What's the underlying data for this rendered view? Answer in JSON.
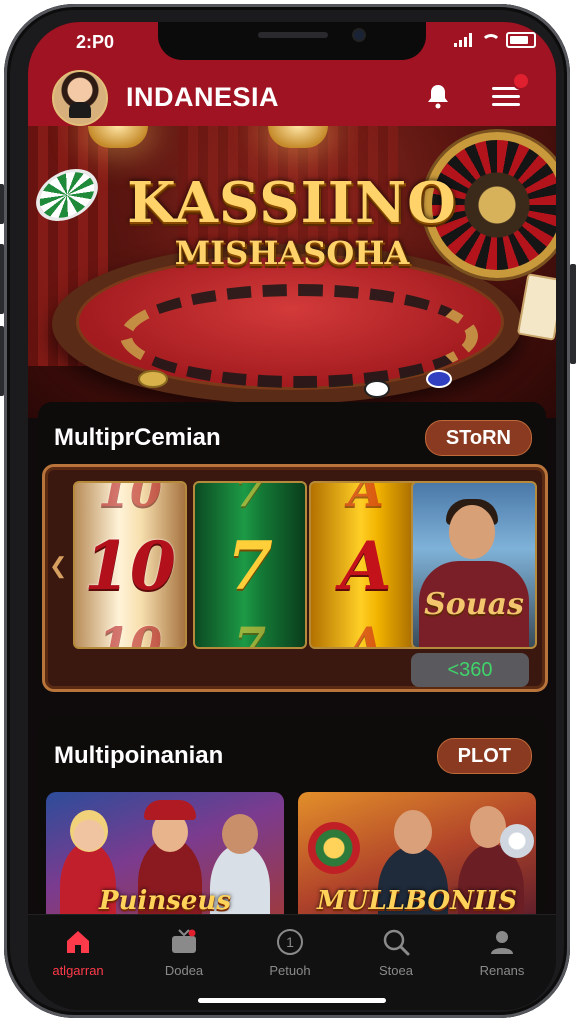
{
  "status": {
    "time": "2:P0"
  },
  "header": {
    "title": "INDANESIA"
  },
  "hero": {
    "title": "KASSIINO",
    "subtitle": "MISHASOHA"
  },
  "section1": {
    "title": "MultiprCemian",
    "button": "SToRN",
    "reels": [
      "10",
      "7",
      "A"
    ],
    "reel_person_label": "Souas",
    "credit": "<360"
  },
  "section2": {
    "title": "Multipoinanian",
    "button": "PLOT",
    "tiles": [
      {
        "label": "Puinseus"
      },
      {
        "label": "MULLBONIIS"
      }
    ]
  },
  "nav": [
    {
      "label": "atlgarran",
      "icon": "home-icon",
      "active": true
    },
    {
      "label": "Dodea",
      "icon": "tv-icon",
      "active": false
    },
    {
      "label": "Petuoh",
      "icon": "info-icon",
      "active": false
    },
    {
      "label": "Stoea",
      "icon": "search-icon",
      "active": false
    },
    {
      "label": "Renans",
      "icon": "user-icon",
      "active": false
    }
  ],
  "colors": {
    "header": "#9f1322",
    "accent": "#ff3a4a",
    "pill": "#8a3a20"
  }
}
